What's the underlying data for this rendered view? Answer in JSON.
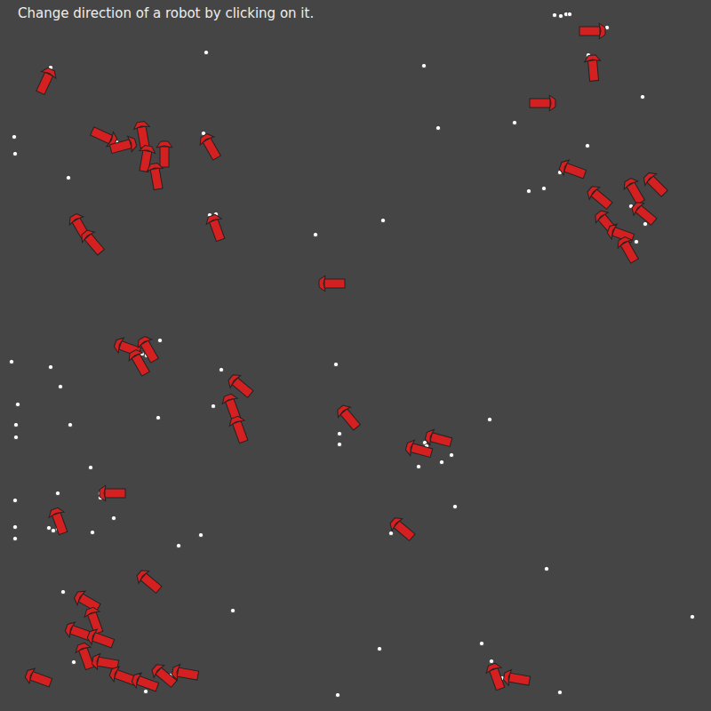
{
  "instruction": "Change direction of a robot by clicking on it."
}
